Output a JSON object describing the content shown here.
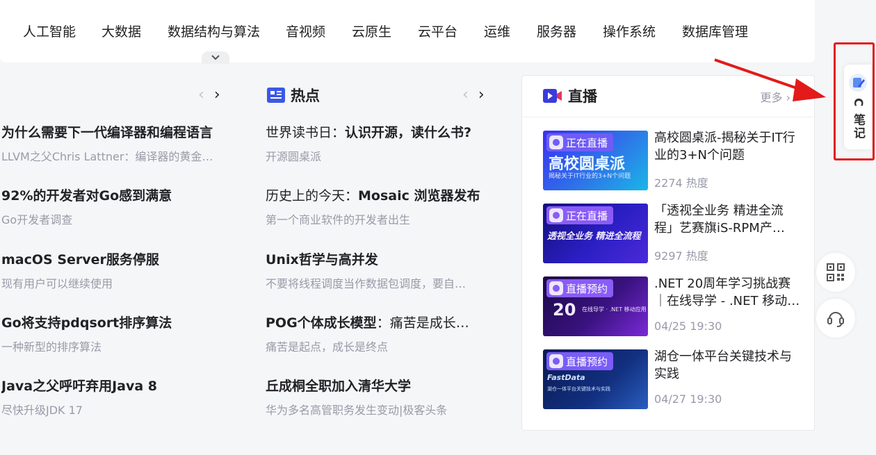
{
  "nav": {
    "categories": [
      "人工智能",
      "大数据",
      "数据结构与算法",
      "音视频",
      "云原生",
      "云平台",
      "运维",
      "服务器",
      "操作系统",
      "数据库管理"
    ]
  },
  "news": {
    "items": [
      {
        "title": "为什么需要下一代编译器和编程语言",
        "subtitle": "LLVM之父Chris Lattner：编译器的黄金…"
      },
      {
        "title": "92%的开发者对Go感到满意",
        "subtitle": "Go开发者调查"
      },
      {
        "title": "macOS Server服务停服",
        "subtitle": "现有用户可以继续使用"
      },
      {
        "title": "Go将支持pdqsort排序算法",
        "subtitle": "一种新型的排序算法"
      },
      {
        "title": "Java之父呼吁弃用Java 8",
        "subtitle": "尽快升级JDK 17"
      }
    ]
  },
  "hot": {
    "title": "热点",
    "items": [
      {
        "prefix": "世界读书日：",
        "title": "认识开源，读什么书?",
        "subtitle": "开源圆桌派"
      },
      {
        "prefix": "历史上的今天：",
        "title": "Mosaic 浏览器发布",
        "subtitle": "第一个商业软件的开发者出生"
      },
      {
        "prefix": "",
        "title": "Unix哲学与高并发",
        "subtitle": "不要将线程调度当作数据包调度，要自…"
      },
      {
        "prefix": "",
        "title": "POG个体成长模型",
        "suffix": "：痛苦是成长…",
        "subtitle": "痛苦是起点，成长是终点"
      },
      {
        "prefix": "",
        "title": "丘成桐全职加入清华大学",
        "subtitle": "华为多名高管职务发生变动|极客头条"
      }
    ]
  },
  "live": {
    "title": "直播",
    "more": "更多",
    "cards": [
      {
        "badge": "正在直播",
        "title": "高校圆桌派-揭秘关于IT行业的3+N个问题",
        "meta": "2274 热度",
        "thumb_text": "高校圆桌派",
        "thumb_sub": "揭秘关于IT行业的3+N个问题",
        "bg": "#2d2bd6",
        "badge_color": "#6f5cf7"
      },
      {
        "badge": "正在直播",
        "title": "「透视全业务 精进全流程」艺赛旗iS-RPM产…",
        "meta": "9297 热度",
        "thumb_text": "透视全业务 精进全流程",
        "thumb_sub": "",
        "bg": "#1d1aa8",
        "badge_color": "#8a5cf7"
      },
      {
        "badge": "直播预约",
        "title": ".NET 20周年学习挑战赛｜在线导学 - .NET 移动…",
        "meta": "04/25 19:30",
        "thumb_text": "20",
        "thumb_sub": "在线导学 · .NET 移动应用",
        "bg": "#2a0f5e",
        "badge_color": "#8a5cf7"
      },
      {
        "badge": "直播预约",
        "title": "湖仓一体平台关键技术与实践",
        "meta": "04/27 19:30",
        "thumb_text": "FastData",
        "thumb_sub": "湖仓一体平台关键技术与实践",
        "bg": "#0d1e5a",
        "badge_color": "#7a5cf7"
      }
    ]
  },
  "sidebar": {
    "note_label": "C 笔记"
  },
  "colors": {
    "accent_red": "#e21a1a",
    "hot_icon": "#3a58e8",
    "live_icon": "#3b3bdc"
  }
}
